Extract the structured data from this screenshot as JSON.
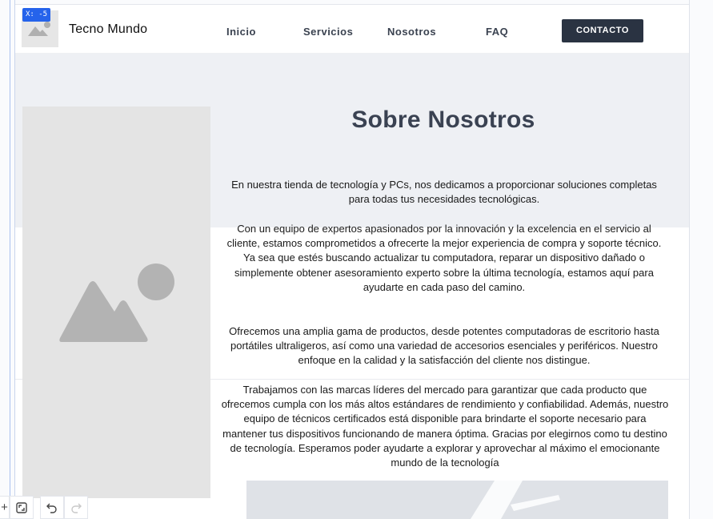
{
  "editor": {
    "coord_badge": "X: -5"
  },
  "header": {
    "brand": "Tecno Mundo",
    "nav": [
      {
        "label": "Inicio"
      },
      {
        "label": "Servicios"
      },
      {
        "label": "Nosotros"
      },
      {
        "label": "FAQ"
      }
    ],
    "contact_button": "CONTACTO"
  },
  "about": {
    "title": "Sobre Nosotros",
    "paragraphs": [
      "En nuestra tienda de tecnología y PCs, nos dedicamos a proporcionar soluciones completas para todas tus necesidades tecnológicas.",
      "Con un equipo de expertos apasionados por la innovación y la excelencia en el servicio al cliente, estamos comprometidos a ofrecerte la mejor experiencia de compra y soporte técnico. Ya sea que estés buscando actualizar tu computadora, reparar un dispositivo dañado o simplemente obtener asesoramiento experto sobre la última tecnología, estamos aquí para ayudarte en cada paso del camino.",
      "Ofrecemos una amplia gama de productos, desde potentes computadoras de escritorio hasta portátiles ultraligeros, así como una variedad de accesorios esenciales y periféricos. Nuestro enfoque en la calidad y la satisfacción del cliente nos distingue.",
      "Trabajamos con las marcas líderes del mercado para garantizar que cada producto que ofrecemos cumpla con los más altos estándares de rendimiento y confiabilidad. Además, nuestro equipo de técnicos certificados está disponible para brindarte el soporte necesario para mantener tus dispositivos funcionando de manera óptima. Gracias por elegirnos como tu destino de tecnología. Esperamos poder ayudarte a explorar y aprovechar al máximo el emocionante mundo de la tecnología"
    ]
  },
  "icons": {
    "add": "plus-icon",
    "fit": "fit-screen-icon",
    "undo": "undo-icon",
    "redo": "redo-icon",
    "placeholder": "image-placeholder-icon"
  },
  "colors": {
    "accent": "#2563eb",
    "header_button": "#2a3342",
    "title": "#3a4252",
    "hero_bg": "#eef0f4",
    "placeholder": "#e4e4e4"
  }
}
